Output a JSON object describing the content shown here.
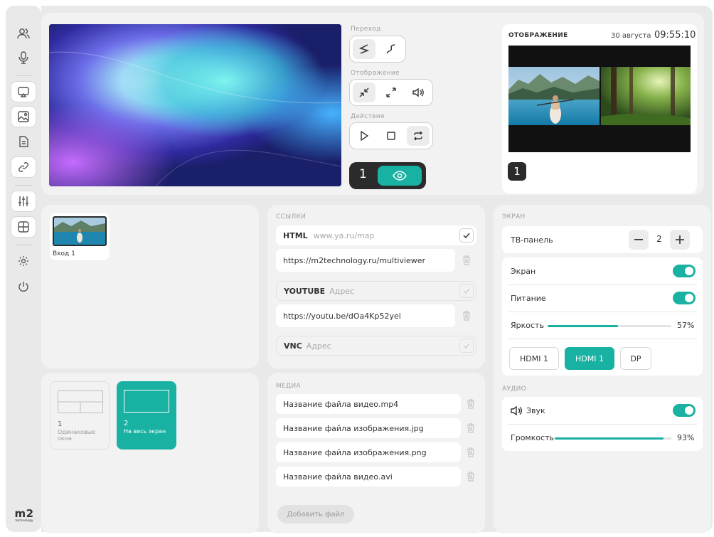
{
  "colors": {
    "accent": "#19b2a2",
    "dark": "#2a2a2a"
  },
  "sidebar": {
    "icons": [
      "users-icon",
      "microphone-icon",
      "cast-icon",
      "image-icon",
      "document-icon",
      "link-icon",
      "sliders-icon",
      "grid-icon",
      "gear-icon",
      "power-icon"
    ],
    "logo_mark": "m2",
    "logo_sub": "technology"
  },
  "preview": {
    "transition_label": "Переход",
    "display_label": "Отображение",
    "actions_label": "Действия",
    "screen_number": "1"
  },
  "monitor": {
    "title": "ОТОБРАЖЕНИЕ",
    "date": "30 августа",
    "time": "09:55:10",
    "screen_number": "1"
  },
  "inputs": {
    "items": [
      {
        "label": "Вход 1"
      }
    ]
  },
  "links": {
    "title": "ССЫЛКИ",
    "html_label": "HTML",
    "html_value": "www.ya.ru/map",
    "html_url": "https://m2technology.ru/multiviewer",
    "youtube_label": "YOUTUBE",
    "youtube_placeholder": "Адрес",
    "youtube_url": "https://youtu.be/dOa4Kp52yel",
    "vnc_label": "VNC",
    "vnc_placeholder": "Адрес"
  },
  "layouts": {
    "items": [
      {
        "num": "1",
        "name": "Одинаковые окна"
      },
      {
        "num": "2",
        "name": "На весь экран"
      }
    ]
  },
  "media": {
    "title": "МЕДИА",
    "files": [
      "Название файла видео.mp4",
      "Название файла изображения.jpg",
      "Название файла изображения.png",
      "Название файла видео.avi"
    ],
    "add_button": "Добавить файл"
  },
  "screen": {
    "title": "ЭКРАН",
    "tv_label": "ТВ-панель",
    "tv_count": "2",
    "screen_label": "Экран",
    "power_label": "Питание",
    "brightness_label": "Яркость",
    "brightness_value": "57%",
    "brightness_fraction": 0.57,
    "sources": [
      "HDMI 1",
      "HDMI 1",
      "DP"
    ],
    "active_source_index": 1
  },
  "audio": {
    "title": "АУДИО",
    "sound_label": "Звук",
    "volume_label": "Громкость",
    "volume_value": "93%",
    "volume_fraction": 0.93
  }
}
